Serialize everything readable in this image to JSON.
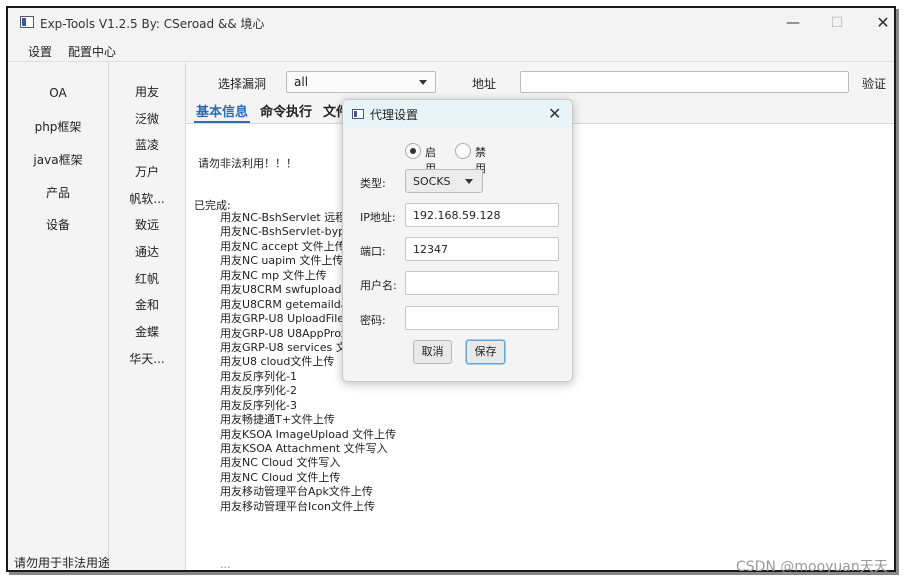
{
  "window": {
    "title": "Exp-Tools V1.2.5   By: CSeroad && 境心"
  },
  "menu": [
    "设置",
    "配置中心"
  ],
  "categories": [
    "OA",
    "php框架",
    "java框架",
    "产品",
    "设备"
  ],
  "footer_text": "请勿用于非法用途",
  "vendors": [
    "用友",
    "泛微",
    "蓝凌",
    "万户",
    "帆软...",
    "致远",
    "通达",
    "红帆",
    "金和",
    "金蝶",
    "华天..."
  ],
  "toolbar": {
    "select_label": "选择漏洞",
    "select_value": "all",
    "address_label": "地址",
    "address_value": "",
    "verify_label": "验证"
  },
  "tabs": [
    "基本信息",
    "命令执行",
    "文件上传"
  ],
  "content": {
    "warning": "请勿非法利用！！！",
    "done_label": "已完成:",
    "completed": [
      "用友NC-BshServlet 远程命",
      "用友NC-BshServlet-bypa",
      "用友NC accept 文件上传",
      "用友NC uapim 文件上传",
      "用友NC mp 文件上传",
      "用友U8CRM swfupload 文",
      "用友U8CRM getemaildat",
      "用友GRP-U8 UploadFileD",
      "用友GRP-U8 U8AppProx",
      "用友GRP-U8 services 文件",
      "用友U8 cloud文件上传",
      "用友反序列化-1",
      "用友反序列化-2",
      "用友反序列化-3",
      "用友畅捷通T+文件上传",
      "用友KSOA ImageUpload 文件上传",
      "用友KSOA Attachment 文件写入",
      "用友NC Cloud 文件写入",
      "用友NC Cloud 文件上传",
      "用友移动管理平台Apk文件上传",
      "用友移动管理平台Icon文件上传"
    ],
    "cut_text": "..."
  },
  "dialog": {
    "title": "代理设置",
    "radio_enable": "启用",
    "radio_disable": "禁用",
    "type_label": "类型:",
    "type_value": "SOCKS",
    "ip_label": "IP地址:",
    "ip_value": "192.168.59.128",
    "port_label": "端口:",
    "port_value": "12347",
    "user_label": "用户名:",
    "user_value": "",
    "pass_label": "密码:",
    "pass_value": "",
    "cancel_label": "取消",
    "save_label": "保存"
  },
  "watermark": "CSDN @mooyuan天天"
}
